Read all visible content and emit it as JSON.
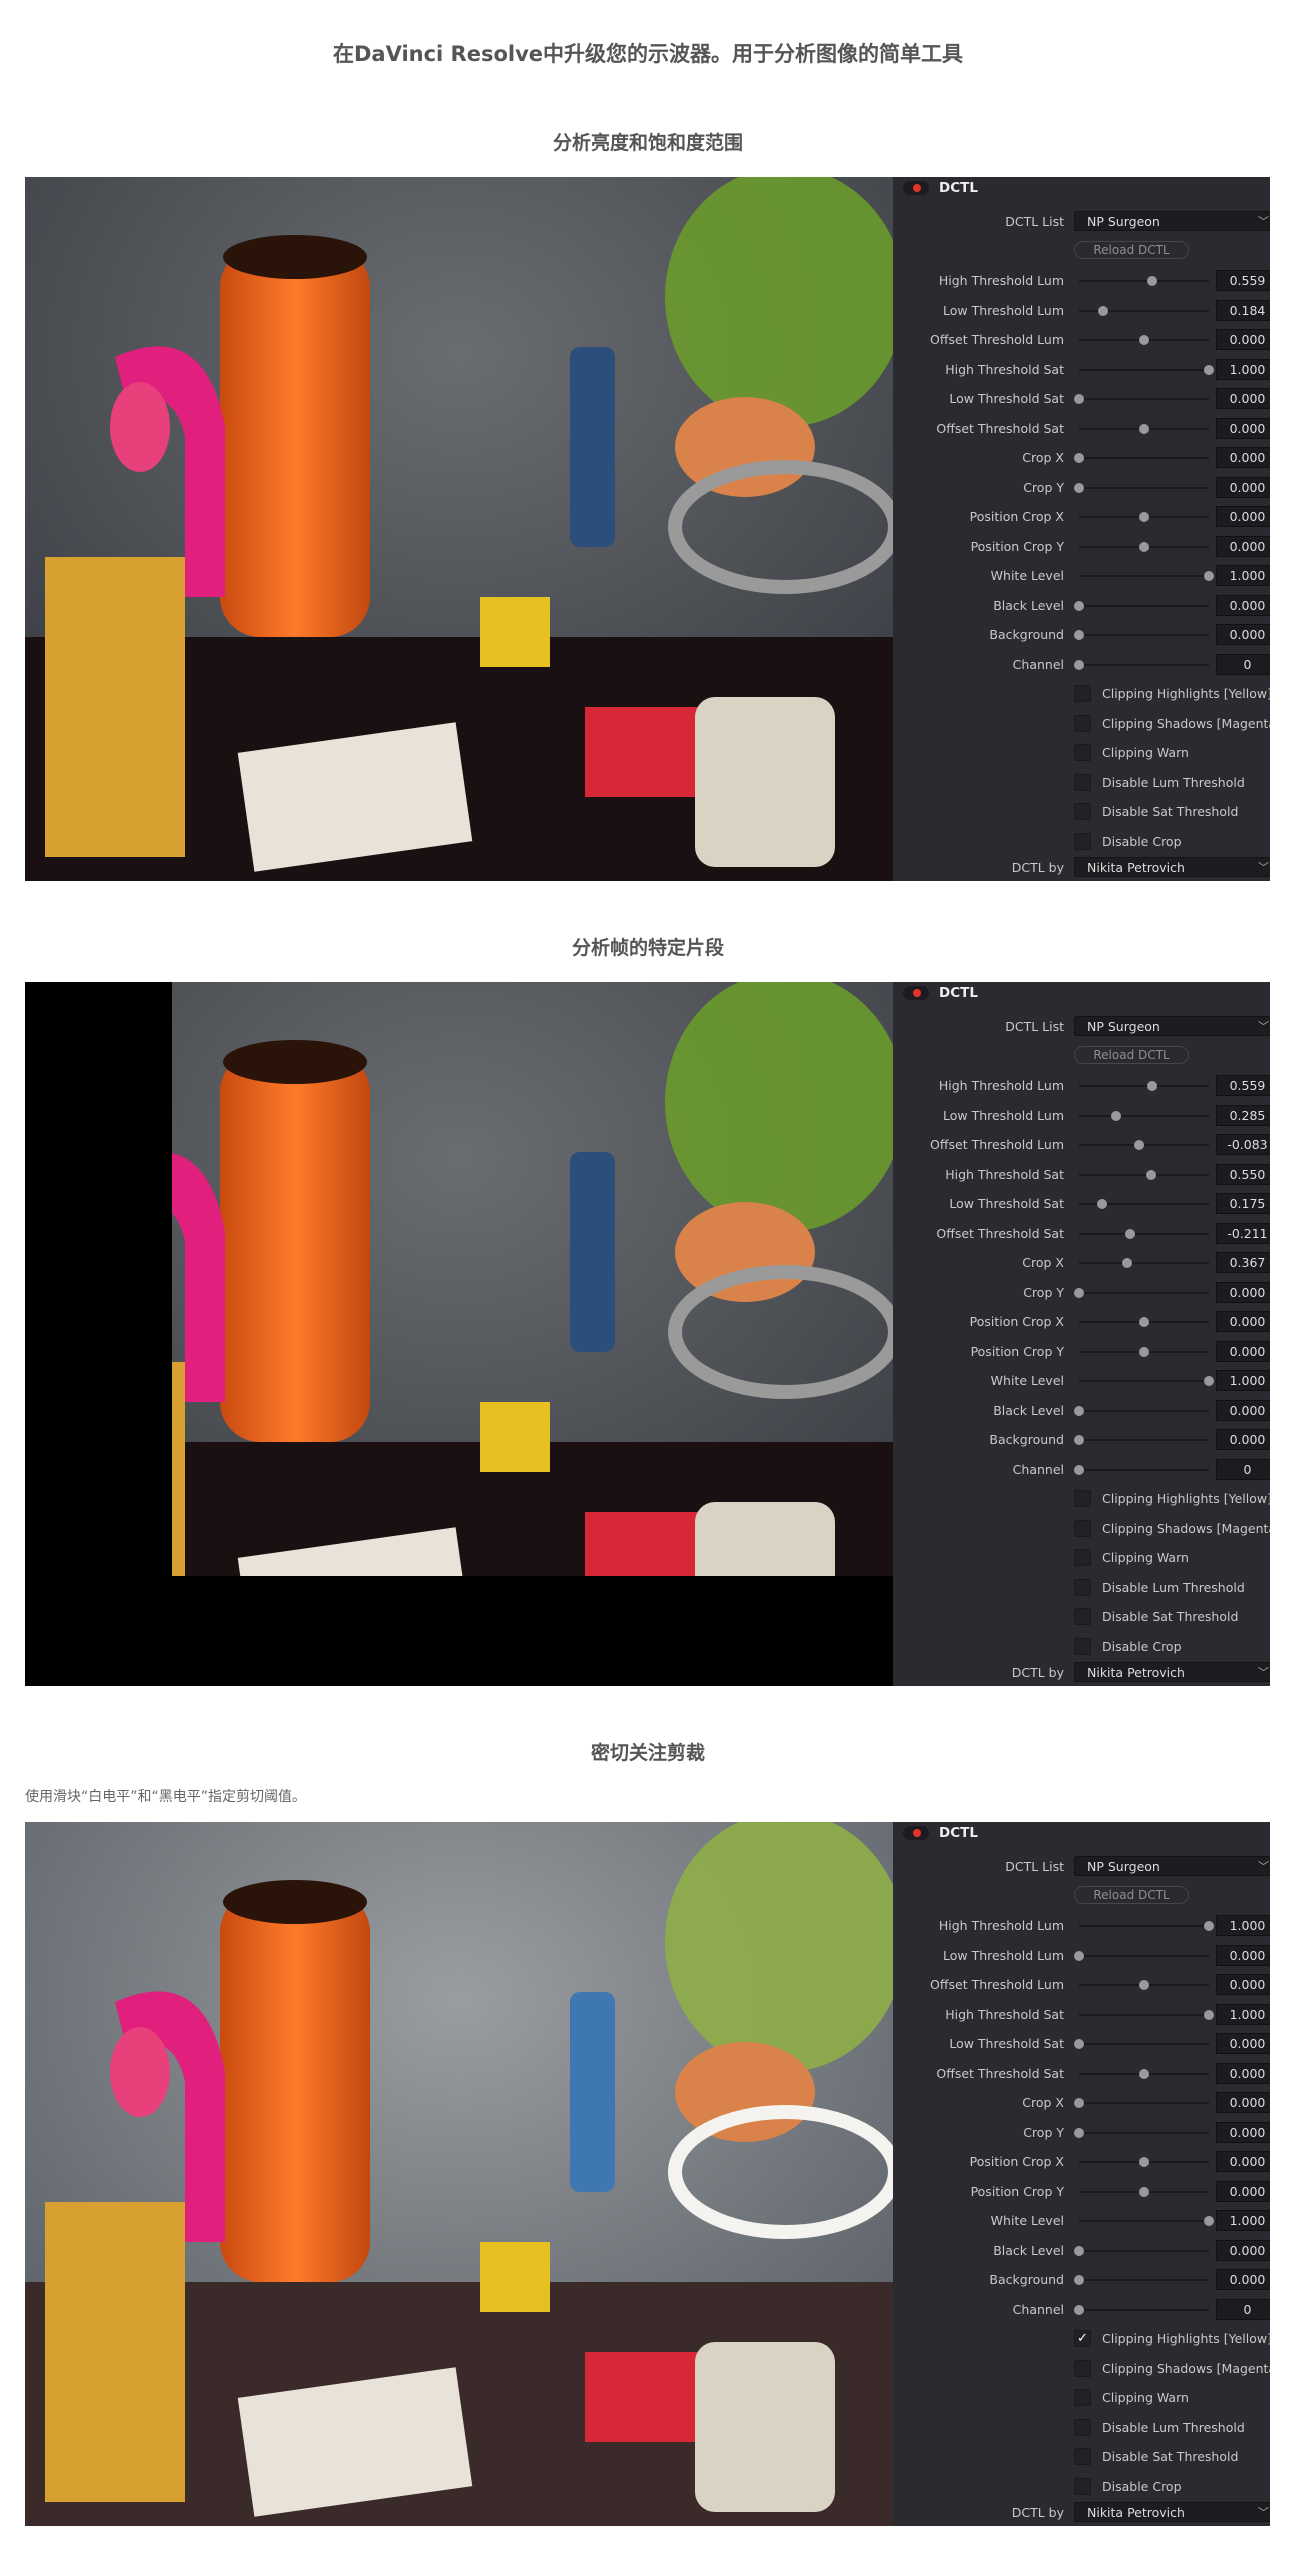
{
  "title": "在DaVinci Resolve中升级您的示波器。用于分析图像的简单工具",
  "colors": {
    "accent_red": "#e5332a",
    "panel_bg": "#2a2a30"
  },
  "sections": [
    {
      "heading": "分析亮度和饱和度范围",
      "caption": "",
      "photo_variant": "threshold-stylized",
      "panel": {
        "header": "DCTL",
        "dctl_list_label": "DCTL List",
        "dctl_list_value": "NP Surgeon",
        "reload_label": "Reload DCTL",
        "sliders": [
          {
            "label": "High Threshold Lum",
            "value": "0.559",
            "level": 0.559,
            "min": 0,
            "max": 1
          },
          {
            "label": "Low Threshold Lum",
            "value": "0.184",
            "level": 0.184,
            "min": 0,
            "max": 1
          },
          {
            "label": "Offset Threshold Lum",
            "value": "0.000",
            "level": 0.0,
            "min": -1,
            "max": 1
          },
          {
            "label": "High Threshold Sat",
            "value": "1.000",
            "level": 1.0,
            "min": 0,
            "max": 1
          },
          {
            "label": "Low Threshold Sat",
            "value": "0.000",
            "level": 0.0,
            "min": 0,
            "max": 1
          },
          {
            "label": "Offset Threshold Sat",
            "value": "0.000",
            "level": 0.0,
            "min": -1,
            "max": 1
          },
          {
            "label": "Crop X",
            "value": "0.000",
            "level": 0.0,
            "min": 0,
            "max": 1
          },
          {
            "label": "Crop Y",
            "value": "0.000",
            "level": 0.0,
            "min": 0,
            "max": 1
          },
          {
            "label": "Position Crop X",
            "value": "0.000",
            "level": 0.0,
            "min": -1,
            "max": 1
          },
          {
            "label": "Position Crop Y",
            "value": "0.000",
            "level": 0.0,
            "min": -1,
            "max": 1
          },
          {
            "label": "White Level",
            "value": "1.000",
            "level": 1.0,
            "min": 0,
            "max": 1
          },
          {
            "label": "Black Level",
            "value": "0.000",
            "level": 0.0,
            "min": 0,
            "max": 1
          },
          {
            "label": "Background",
            "value": "0.000",
            "level": 0.0,
            "min": 0,
            "max": 1
          },
          {
            "label": "Channel",
            "value": "0",
            "level": 0,
            "min": 0,
            "max": 1
          }
        ],
        "checkboxes": [
          {
            "label": "Clipping Highlights [Yellow]",
            "checked": false
          },
          {
            "label": "Clipping Shadows [Magenta]",
            "checked": false
          },
          {
            "label": "Clipping Warn",
            "checked": false
          },
          {
            "label": "Disable Lum Threshold",
            "checked": false
          },
          {
            "label": "Disable Sat Threshold",
            "checked": false
          },
          {
            "label": "Disable Crop",
            "checked": false
          }
        ],
        "dctl_by_label": "DCTL by",
        "dctl_by_value": "Nikita Petrovich"
      }
    },
    {
      "heading": "分析帧的特定片段",
      "caption": "",
      "photo_variant": "cropped",
      "panel": {
        "header": "DCTL",
        "dctl_list_label": "DCTL List",
        "dctl_list_value": "NP Surgeon",
        "reload_label": "Reload DCTL",
        "sliders": [
          {
            "label": "High Threshold Lum",
            "value": "0.559",
            "level": 0.559,
            "min": 0,
            "max": 1
          },
          {
            "label": "Low Threshold Lum",
            "value": "0.285",
            "level": 0.285,
            "min": 0,
            "max": 1
          },
          {
            "label": "Offset Threshold Lum",
            "value": "-0.083",
            "level": -0.083,
            "min": -1,
            "max": 1
          },
          {
            "label": "High Threshold Sat",
            "value": "0.550",
            "level": 0.55,
            "min": 0,
            "max": 1
          },
          {
            "label": "Low Threshold Sat",
            "value": "0.175",
            "level": 0.175,
            "min": 0,
            "max": 1
          },
          {
            "label": "Offset Threshold Sat",
            "value": "-0.211",
            "level": -0.211,
            "min": -1,
            "max": 1
          },
          {
            "label": "Crop X",
            "value": "0.367",
            "level": 0.367,
            "min": 0,
            "max": 1
          },
          {
            "label": "Crop Y",
            "value": "0.000",
            "level": 0.0,
            "min": 0,
            "max": 1
          },
          {
            "label": "Position Crop X",
            "value": "0.000",
            "level": 0.0,
            "min": -1,
            "max": 1
          },
          {
            "label": "Position Crop Y",
            "value": "0.000",
            "level": 0.0,
            "min": -1,
            "max": 1
          },
          {
            "label": "White Level",
            "value": "1.000",
            "level": 1.0,
            "min": 0,
            "max": 1
          },
          {
            "label": "Black Level",
            "value": "0.000",
            "level": 0.0,
            "min": 0,
            "max": 1
          },
          {
            "label": "Background",
            "value": "0.000",
            "level": 0.0,
            "min": 0,
            "max": 1
          },
          {
            "label": "Channel",
            "value": "0",
            "level": 0,
            "min": 0,
            "max": 1
          }
        ],
        "checkboxes": [
          {
            "label": "Clipping Highlights [Yellow]",
            "checked": false
          },
          {
            "label": "Clipping Shadows [Magenta]",
            "checked": false
          },
          {
            "label": "Clipping Warn",
            "checked": false
          },
          {
            "label": "Disable Lum Threshold",
            "checked": false
          },
          {
            "label": "Disable Sat Threshold",
            "checked": false
          },
          {
            "label": "Disable Crop",
            "checked": false
          }
        ],
        "dctl_by_label": "DCTL by",
        "dctl_by_value": "Nikita Petrovich"
      }
    },
    {
      "heading": "密切关注剪裁",
      "caption": "使用滑块“白电平”和“黑电平”指定剪切阈值。",
      "photo_variant": "full",
      "panel": {
        "header": "DCTL",
        "dctl_list_label": "DCTL List",
        "dctl_list_value": "NP Surgeon",
        "reload_label": "Reload DCTL",
        "sliders": [
          {
            "label": "High Threshold Lum",
            "value": "1.000",
            "level": 1.0,
            "min": 0,
            "max": 1
          },
          {
            "label": "Low Threshold Lum",
            "value": "0.000",
            "level": 0.0,
            "min": 0,
            "max": 1
          },
          {
            "label": "Offset Threshold Lum",
            "value": "0.000",
            "level": 0.0,
            "min": -1,
            "max": 1
          },
          {
            "label": "High Threshold Sat",
            "value": "1.000",
            "level": 1.0,
            "min": 0,
            "max": 1
          },
          {
            "label": "Low Threshold Sat",
            "value": "0.000",
            "level": 0.0,
            "min": 0,
            "max": 1
          },
          {
            "label": "Offset Threshold Sat",
            "value": "0.000",
            "level": 0.0,
            "min": -1,
            "max": 1
          },
          {
            "label": "Crop X",
            "value": "0.000",
            "level": 0.0,
            "min": 0,
            "max": 1
          },
          {
            "label": "Crop Y",
            "value": "0.000",
            "level": 0.0,
            "min": 0,
            "max": 1
          },
          {
            "label": "Position Crop X",
            "value": "0.000",
            "level": 0.0,
            "min": -1,
            "max": 1
          },
          {
            "label": "Position Crop Y",
            "value": "0.000",
            "level": 0.0,
            "min": -1,
            "max": 1
          },
          {
            "label": "White Level",
            "value": "1.000",
            "level": 1.0,
            "min": 0,
            "max": 1
          },
          {
            "label": "Black Level",
            "value": "0.000",
            "level": 0.0,
            "min": 0,
            "max": 1
          },
          {
            "label": "Background",
            "value": "0.000",
            "level": 0.0,
            "min": 0,
            "max": 1
          },
          {
            "label": "Channel",
            "value": "0",
            "level": 0,
            "min": 0,
            "max": 1
          }
        ],
        "checkboxes": [
          {
            "label": "Clipping Highlights [Yellow]",
            "checked": true
          },
          {
            "label": "Clipping Shadows [Magenta]",
            "checked": false
          },
          {
            "label": "Clipping Warn",
            "checked": false
          },
          {
            "label": "Disable Lum Threshold",
            "checked": false
          },
          {
            "label": "Disable Sat Threshold",
            "checked": false
          },
          {
            "label": "Disable Crop",
            "checked": false
          }
        ],
        "dctl_by_label": "DCTL by",
        "dctl_by_value": "Nikita Petrovich"
      }
    }
  ]
}
